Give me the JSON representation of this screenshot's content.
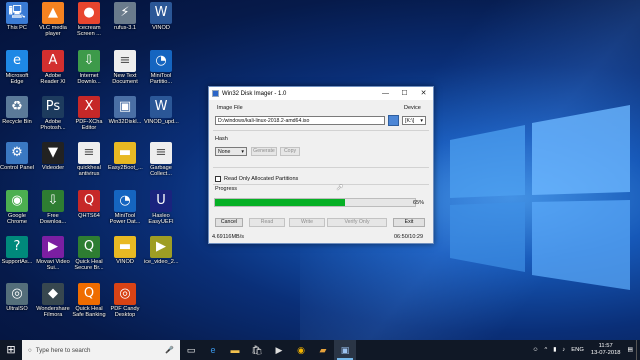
{
  "desktop_icons": [
    {
      "label": "This PC",
      "icon": "this-pc-icon",
      "glyph": "🖳",
      "color": "#3a7bd5"
    },
    {
      "label": "VLC media player",
      "icon": "vlc-icon",
      "glyph": "▲",
      "color": "#f58220"
    },
    {
      "label": "Icecream Screen ...",
      "icon": "icecream-icon",
      "glyph": "●",
      "color": "#e8452e"
    },
    {
      "label": "rufus-3.1",
      "icon": "usb-icon",
      "glyph": "⚡",
      "color": "#6a7b8c"
    },
    {
      "label": "VINOD",
      "icon": "document-icon",
      "glyph": "W",
      "color": "#2b5797"
    },
    {
      "label": "Microsoft Edge",
      "icon": "edge-icon",
      "glyph": "e",
      "color": "#1e88e5"
    },
    {
      "label": "Adobe Reader XI",
      "icon": "acrobat-icon",
      "glyph": "A",
      "color": "#d32f2f"
    },
    {
      "label": "Internet Downlo...",
      "icon": "idm-icon",
      "glyph": "⇩",
      "color": "#3d9a4a"
    },
    {
      "label": "New Text Document",
      "icon": "text-file-icon",
      "glyph": "≡",
      "color": "#eeeeee"
    },
    {
      "label": "MiniTool Partitio...",
      "icon": "minitool-icon",
      "glyph": "◔",
      "color": "#1565c0"
    },
    {
      "label": "Recycle Bin",
      "icon": "recycle-bin-icon",
      "glyph": "♻",
      "color": "#5b7a99"
    },
    {
      "label": "Adobe Photosh...",
      "icon": "photoshop-icon",
      "glyph": "Ps",
      "color": "#1d3b5e"
    },
    {
      "label": "PDF-XCha Editor",
      "icon": "pdf-xchange-icon",
      "glyph": "X",
      "color": "#c62828"
    },
    {
      "label": "Win32Diskl...",
      "icon": "disk-imager-icon",
      "glyph": "▣",
      "color": "#4a6fa5"
    },
    {
      "label": "VINOD_upd...",
      "icon": "document-icon",
      "glyph": "W",
      "color": "#2b5797"
    },
    {
      "label": "Control Panel",
      "icon": "control-panel-icon",
      "glyph": "⚙",
      "color": "#3a78c2"
    },
    {
      "label": "Videoder",
      "icon": "videoder-icon",
      "glyph": "▼",
      "color": "#222222"
    },
    {
      "label": "quickheal antivirus",
      "icon": "text-file-icon",
      "glyph": "≡",
      "color": "#eeeeee"
    },
    {
      "label": "Easy2Boot_...",
      "icon": "folder-icon",
      "glyph": "▬",
      "color": "#e8b923"
    },
    {
      "label": "Garbage Collect...",
      "icon": "text-file-icon",
      "glyph": "≡",
      "color": "#eeeeee"
    },
    {
      "label": "Google Chrome",
      "icon": "chrome-icon",
      "glyph": "◉",
      "color": "#4caf50"
    },
    {
      "label": "Free Downloa...",
      "icon": "free-download-icon",
      "glyph": "⇩",
      "color": "#2e7d32"
    },
    {
      "label": "QHTS64",
      "icon": "quickheal-icon",
      "glyph": "Q",
      "color": "#c62828"
    },
    {
      "label": "MiniTool Power Dat...",
      "icon": "minitool-icon",
      "glyph": "◔",
      "color": "#1565c0"
    },
    {
      "label": "Hasleo EasyUEFI",
      "icon": "hasleo-icon",
      "glyph": "U",
      "color": "#1a237e"
    },
    {
      "label": "SupportAs...",
      "icon": "support-icon",
      "glyph": "?",
      "color": "#00897b"
    },
    {
      "label": "Movavi Video Sui...",
      "icon": "movavi-icon",
      "glyph": "▶",
      "color": "#7b1fa2"
    },
    {
      "label": "Quick Heal Secure Br...",
      "icon": "quickheal-icon",
      "glyph": "Q",
      "color": "#2e7d32"
    },
    {
      "label": "VINOD",
      "icon": "folder-icon",
      "glyph": "▬",
      "color": "#e8b923"
    },
    {
      "label": "ice_video_2...",
      "icon": "video-file-icon",
      "glyph": "▶",
      "color": "#9e9d24"
    },
    {
      "label": "UltraISO",
      "icon": "ultraiso-icon",
      "glyph": "◎",
      "color": "#546e7a"
    },
    {
      "label": "Wondershare Filmora",
      "icon": "filmora-icon",
      "glyph": "◆",
      "color": "#37474f"
    },
    {
      "label": "Quick Heal Safe Banking",
      "icon": "quickheal-icon",
      "glyph": "Q",
      "color": "#ef6c00"
    },
    {
      "label": "PDF Candy Desktop",
      "icon": "pdf-candy-icon",
      "glyph": "◎",
      "color": "#d84315"
    }
  ],
  "dialog": {
    "title": "Win32 Disk Imager - 1.0",
    "image_file_label": "Image File",
    "image_file_value": "D:/windows/kali-linux-2018.2-amd64.iso",
    "device_label": "Device",
    "device_value": "[K:\\]",
    "hash_label": "Hash",
    "hash_value": "None",
    "generate_label": "Generate",
    "copy_label": "Copy",
    "readonly_label": "Read Only Allocated Partitions",
    "progress_label": "Progress",
    "progress_value": 0.65,
    "progress_text": "65%",
    "cancel_label": "Cancel",
    "read_label": "Read",
    "write_label": "Write",
    "verify_label": "Verify Only",
    "exit_label": "Exit",
    "speed_text": "4.69116MB/s",
    "time_text": "06:50/10:29"
  },
  "taskbar": {
    "search_placeholder": "Type here to search",
    "tray_language": "ENG",
    "time": "11:57",
    "date": "13-07-2018"
  },
  "colors": {
    "progress": "#06b025",
    "taskbar": "#101826"
  }
}
